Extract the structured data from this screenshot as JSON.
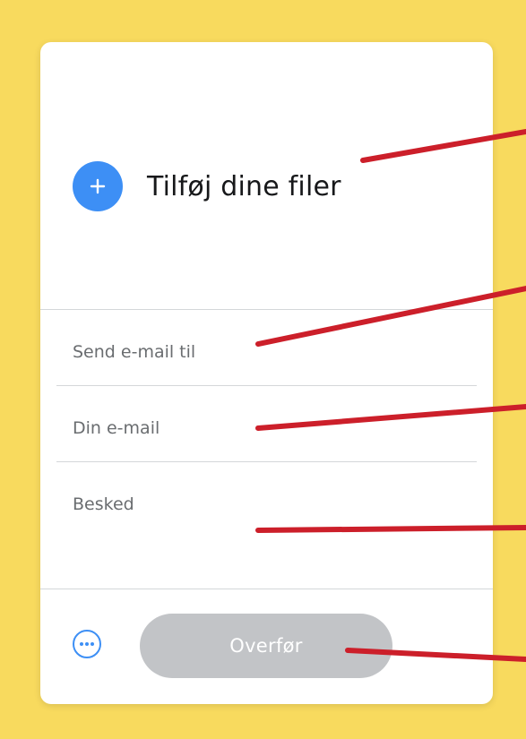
{
  "upload": {
    "add_files_label": "Tilføj dine filer"
  },
  "form": {
    "send_to_placeholder": "Send e-mail til",
    "your_email_placeholder": "Din e-mail",
    "message_placeholder": "Besked"
  },
  "footer": {
    "more_options_icon": "ellipsis-circle-icon",
    "transfer_label": "Overfør"
  },
  "colors": {
    "background": "#f8da5e",
    "accent": "#3d8ff5",
    "disabled_button": "#c2c4c7",
    "annotation": "#cc1f2a"
  }
}
